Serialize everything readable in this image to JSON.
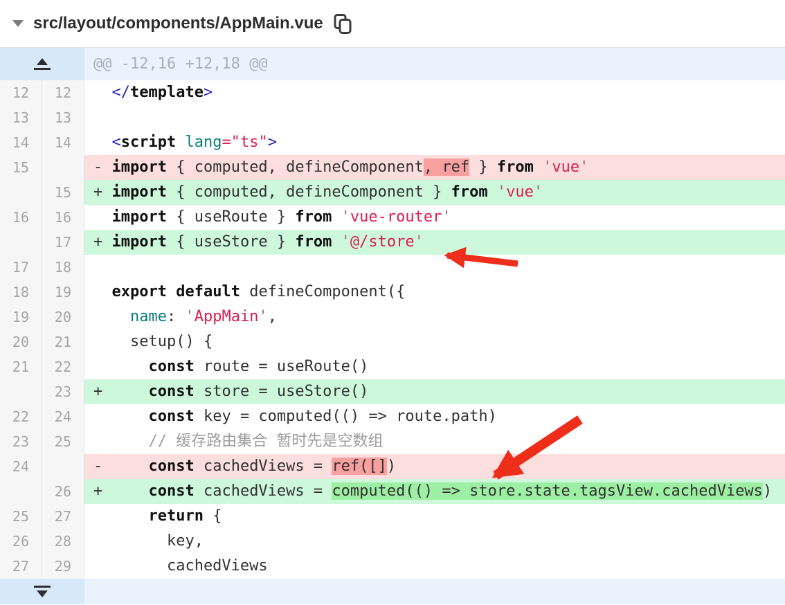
{
  "header": {
    "filename": "src/layout/components/AppMain.vue",
    "collapse_icon": "chevron-down-icon",
    "copy_icon": "copy-icon"
  },
  "colors": {
    "border": "#e0e0e0",
    "header_text": "#2d2d2d",
    "gutter_bg": "#f6f6f6",
    "gutter_border": "#e1e1e1",
    "number": "#a6a6a6",
    "hunk_gutter": "#d6e8fa",
    "hunk_content": "#eaf2fc",
    "hunk_text": "#a8b0b8",
    "add_line": "#cdf8dc",
    "add_word": "#9df0a3",
    "del_line": "#fcdede",
    "del_word": "#f89f9f",
    "code_default": "#323232",
    "keyword": "#111111",
    "tag": "#2424b4",
    "attr": "#087e7b",
    "string": "#dc1d50",
    "quote": "#a96c6c",
    "comment": "#9e9e9e",
    "arrow": "#ee2d1a"
  },
  "diff": {
    "expand_up_icon": "expand-up-icon",
    "expand_down_icon": "expand-down-icon",
    "rows": [
      {
        "type": "hunk",
        "text": "@@ -12,16 +12,18 @@"
      },
      {
        "type": "ctx",
        "old": "12",
        "new": "12",
        "segs": [
          [
            "  ",
            ""
          ],
          [
            "</",
            "t"
          ],
          [
            "template",
            "k"
          ],
          [
            ">",
            "t"
          ]
        ]
      },
      {
        "type": "ctx",
        "old": "13",
        "new": "13",
        "segs": []
      },
      {
        "type": "ctx",
        "old": "14",
        "new": "14",
        "segs": [
          [
            "  ",
            ""
          ],
          [
            "<",
            "t"
          ],
          [
            "script",
            "k"
          ],
          [
            " ",
            ""
          ],
          [
            "lang",
            "a"
          ],
          [
            "=",
            "s"
          ],
          [
            "\"ts\"",
            "s"
          ],
          [
            ">",
            "t"
          ]
        ]
      },
      {
        "type": "del",
        "old": "15",
        "new": "",
        "segs": [
          [
            "- ",
            ""
          ],
          [
            "import",
            "k"
          ],
          [
            " { computed, defineComponent",
            ""
          ],
          [
            ", ref",
            "wd"
          ],
          [
            " } ",
            ""
          ],
          [
            "from",
            "k"
          ],
          [
            " ",
            ""
          ],
          [
            "'",
            "q"
          ],
          [
            "vue",
            "s"
          ],
          [
            "'",
            "q"
          ]
        ]
      },
      {
        "type": "add",
        "old": "",
        "new": "15",
        "segs": [
          [
            "+ ",
            ""
          ],
          [
            "import",
            "k"
          ],
          [
            " { computed, defineComponent } ",
            ""
          ],
          [
            "from",
            "k"
          ],
          [
            " ",
            ""
          ],
          [
            "'",
            "q"
          ],
          [
            "vue",
            "s"
          ],
          [
            "'",
            "q"
          ]
        ]
      },
      {
        "type": "ctx",
        "old": "16",
        "new": "16",
        "segs": [
          [
            "  ",
            ""
          ],
          [
            "import",
            "k"
          ],
          [
            " { useRoute } ",
            ""
          ],
          [
            "from",
            "k"
          ],
          [
            " ",
            ""
          ],
          [
            "'",
            "q"
          ],
          [
            "vue-router",
            "s"
          ],
          [
            "'",
            "q"
          ]
        ]
      },
      {
        "type": "add",
        "old": "",
        "new": "17",
        "segs": [
          [
            "+ ",
            ""
          ],
          [
            "import",
            "k"
          ],
          [
            " { useStore } ",
            ""
          ],
          [
            "from",
            "k"
          ],
          [
            " ",
            ""
          ],
          [
            "'",
            "q"
          ],
          [
            "@/store",
            "s"
          ],
          [
            "'",
            "q"
          ]
        ]
      },
      {
        "type": "ctx",
        "old": "17",
        "new": "18",
        "segs": []
      },
      {
        "type": "ctx",
        "old": "18",
        "new": "19",
        "segs": [
          [
            "  ",
            ""
          ],
          [
            "export",
            "k"
          ],
          [
            " ",
            ""
          ],
          [
            "default",
            "k"
          ],
          [
            " defineComponent({",
            ""
          ]
        ]
      },
      {
        "type": "ctx",
        "old": "19",
        "new": "20",
        "segs": [
          [
            "    ",
            ""
          ],
          [
            "name",
            "a"
          ],
          [
            ": ",
            ""
          ],
          [
            "'",
            "q"
          ],
          [
            "AppMain",
            "s"
          ],
          [
            "'",
            "q"
          ],
          [
            ",",
            ""
          ]
        ]
      },
      {
        "type": "ctx",
        "old": "20",
        "new": "21",
        "segs": [
          [
            "    setup() {",
            ""
          ]
        ]
      },
      {
        "type": "ctx",
        "old": "21",
        "new": "22",
        "segs": [
          [
            "      ",
            ""
          ],
          [
            "const",
            "k"
          ],
          [
            " route = useRoute()",
            ""
          ]
        ]
      },
      {
        "type": "add",
        "old": "",
        "new": "23",
        "segs": [
          [
            "+     ",
            ""
          ],
          [
            "const",
            "k"
          ],
          [
            " store = useStore()",
            ""
          ]
        ]
      },
      {
        "type": "ctx",
        "old": "22",
        "new": "24",
        "segs": [
          [
            "      ",
            ""
          ],
          [
            "const",
            "k"
          ],
          [
            " key = computed(() => route.path)",
            ""
          ]
        ]
      },
      {
        "type": "ctx",
        "old": "23",
        "new": "25",
        "segs": [
          [
            "      ",
            ""
          ],
          [
            "// 缓存路由集合 暂时先是空数组",
            "c"
          ]
        ]
      },
      {
        "type": "del",
        "old": "24",
        "new": "",
        "segs": [
          [
            "-     ",
            ""
          ],
          [
            "const",
            "k"
          ],
          [
            " cachedViews = ",
            ""
          ],
          [
            "ref([]",
            "wd"
          ],
          [
            ")",
            ""
          ]
        ]
      },
      {
        "type": "add",
        "old": "",
        "new": "26",
        "segs": [
          [
            "+     ",
            ""
          ],
          [
            "const",
            "k"
          ],
          [
            " cachedViews = ",
            ""
          ],
          [
            "computed(() => store.state.tagsView.cachedViews",
            "wa"
          ],
          [
            ")",
            ""
          ]
        ]
      },
      {
        "type": "ctx",
        "old": "25",
        "new": "27",
        "segs": [
          [
            "      ",
            ""
          ],
          [
            "return",
            "k"
          ],
          [
            " {",
            ""
          ]
        ]
      },
      {
        "type": "ctx",
        "old": "26",
        "new": "28",
        "segs": [
          [
            "        key,",
            ""
          ]
        ]
      },
      {
        "type": "ctx",
        "old": "27",
        "new": "29",
        "segs": [
          [
            "        cachedViews",
            ""
          ]
        ]
      },
      {
        "type": "expand"
      }
    ]
  },
  "annotations": {
    "arrow_color": "#ee2d1a",
    "arrows": [
      {
        "points_to": "import { useStore } from '@/store'"
      },
      {
        "points_to": "computed(() => store.state.tagsView.cachedViews)"
      }
    ]
  }
}
